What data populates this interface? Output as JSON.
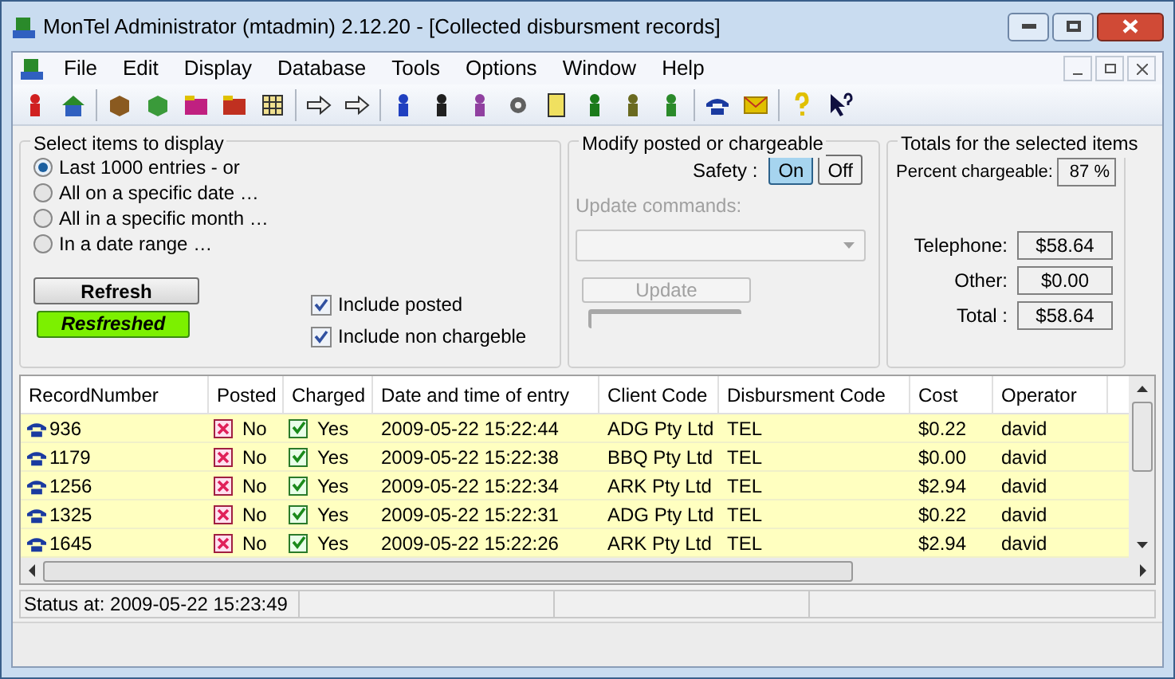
{
  "window": {
    "title": "MonTel Administrator (mtadmin) 2.12.20 - [Collected disbursment records]"
  },
  "menu": [
    "File",
    "Edit",
    "Display",
    "Database",
    "Tools",
    "Options",
    "Window",
    "Help"
  ],
  "select_panel": {
    "title": "Select items to display",
    "options": [
      {
        "label": "Last 1000 entries - or",
        "selected": true
      },
      {
        "label": "All on a specific date …",
        "selected": false
      },
      {
        "label": "All in a specific month …",
        "selected": false
      },
      {
        "label": "In a date range …",
        "selected": false
      }
    ],
    "refresh_button": "Refresh",
    "refresh_status": "Resfreshed",
    "checkboxes": [
      {
        "label": "Include posted",
        "checked": true
      },
      {
        "label": "Include non chargeble",
        "checked": true
      }
    ]
  },
  "modify_panel": {
    "title": "Modify posted or chargeable",
    "safety_label": "Safety :",
    "safety": [
      {
        "label": "On",
        "selected": true
      },
      {
        "label": "Off",
        "selected": false
      }
    ],
    "update_commands_label": "Update commands:",
    "update_button": "Update",
    "progress": {
      "level": 0
    }
  },
  "totals_panel": {
    "title": "Totals for the selected items",
    "percent_label": "Percent chargeable:",
    "percent": "87 %",
    "rows": [
      {
        "label": "Telephone:",
        "value": "$58.64"
      },
      {
        "label": "Other:",
        "value": "$0.00"
      },
      {
        "label": "Total :",
        "value": "$58.64"
      }
    ]
  },
  "table": {
    "columns": [
      "RecordNumber",
      "Posted",
      "Charged",
      "Date and time of entry",
      "Client Code",
      "Disbursment Code",
      "Cost",
      "Operator"
    ],
    "rows": [
      {
        "record": "936",
        "posted": false,
        "posted_text": "No",
        "charged": true,
        "charged_text": "Yes",
        "date": "2009-05-22 15:22:44",
        "client": "ADG Pty Ltd",
        "code": "TEL",
        "cost": "$0.22",
        "operator": "david"
      },
      {
        "record": "1179",
        "posted": false,
        "posted_text": "No",
        "charged": true,
        "charged_text": "Yes",
        "date": "2009-05-22 15:22:38",
        "client": "BBQ Pty Ltd",
        "code": "TEL",
        "cost": "$0.00",
        "operator": "david"
      },
      {
        "record": "1256",
        "posted": false,
        "posted_text": "No",
        "charged": true,
        "charged_text": "Yes",
        "date": "2009-05-22 15:22:34",
        "client": "ARK Pty Ltd",
        "code": "TEL",
        "cost": "$2.94",
        "operator": "david"
      },
      {
        "record": "1325",
        "posted": false,
        "posted_text": "No",
        "charged": true,
        "charged_text": "Yes",
        "date": "2009-05-22 15:22:31",
        "client": "ADG Pty Ltd",
        "code": "TEL",
        "cost": "$0.22",
        "operator": "david"
      },
      {
        "record": "1645",
        "posted": false,
        "posted_text": "No",
        "charged": true,
        "charged_text": "Yes",
        "date": "2009-05-22 15:22:26",
        "client": "ARK Pty Ltd",
        "code": "TEL",
        "cost": "$2.94",
        "operator": "david"
      }
    ]
  },
  "status_bar": {
    "text": "Status at: 2009-05-22 15:23:49"
  }
}
